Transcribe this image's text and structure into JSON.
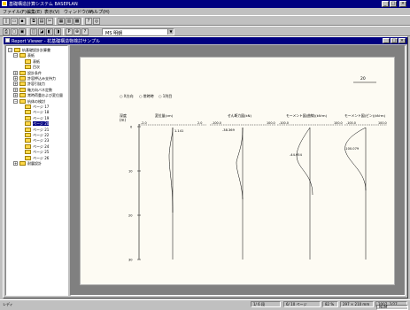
{
  "app": {
    "title": "基礎構造計算システム BASEPLAN",
    "min": "_",
    "max": "□",
    "close": "×"
  },
  "menu": [
    "ファイル(F)",
    "編集(E)",
    "表示(V)",
    "ウィンドウ(W)",
    "ヘルプ(H)"
  ],
  "toolbar": {
    "row1": [
      "new-icon",
      "open-icon",
      "save-icon",
      "copy-icon",
      "paste-icon",
      "table-icon",
      "chart-icon",
      "cut-icon",
      "question-icon",
      "help-icon"
    ],
    "row2": [
      "print-icon",
      "page-icon",
      "page-icon",
      "print-preview-icon",
      "preview-icon",
      "p-icon",
      "zoom-icon",
      "help-icon"
    ],
    "font_combo": "MS 明朝",
    "p_label": "P"
  },
  "doc": {
    "title": "Report Viewer - 杭基礎構造物検討サンプル"
  },
  "tree": [
    {
      "label": "杭基礎設計計算書",
      "level": 0,
      "exp": "−"
    },
    {
      "label": "表紙",
      "level": 1,
      "exp": "−"
    },
    {
      "label": "表紙",
      "level": 2,
      "exp": ""
    },
    {
      "label": "目次",
      "level": 2,
      "exp": ""
    },
    {
      "label": "設計条件",
      "level": 1,
      "exp": "+"
    },
    {
      "label": "許容押込み支持力",
      "level": 1,
      "exp": "+"
    },
    {
      "label": "許容引抜力",
      "level": 1,
      "exp": "+"
    },
    {
      "label": "軸方向バネ定数",
      "level": 1,
      "exp": "+"
    },
    {
      "label": "常時荷重および変位量",
      "level": 1,
      "exp": "+"
    },
    {
      "label": "杭体の検討",
      "level": 1,
      "exp": "−"
    },
    {
      "label": "ページ 17",
      "level": 2,
      "exp": ""
    },
    {
      "label": "ページ 18",
      "level": 2,
      "exp": ""
    },
    {
      "label": "ページ 19",
      "level": 2,
      "exp": ""
    },
    {
      "label": "ページ 20",
      "level": 2,
      "exp": "",
      "selected": true
    },
    {
      "label": "ページ 21",
      "level": 2,
      "exp": ""
    },
    {
      "label": "ページ 22",
      "level": 2,
      "exp": ""
    },
    {
      "label": "ページ 23",
      "level": 2,
      "exp": ""
    },
    {
      "label": "ページ 24",
      "level": 2,
      "exp": ""
    },
    {
      "label": "ページ 25",
      "level": 2,
      "exp": ""
    },
    {
      "label": "ページ 26",
      "level": 2,
      "exp": ""
    },
    {
      "label": "耐震設計",
      "level": 1,
      "exp": "+"
    }
  ],
  "page": {
    "page_number": "20",
    "legend": [
      "○ X方向",
      "○ 常時時",
      "○ 1列目"
    ],
    "depth_label": "深度",
    "depth_unit": "(m)",
    "columns": [
      {
        "title": "変位量(cm)",
        "left": "-2.0",
        "right": "2.0",
        "value": "1.141"
      },
      {
        "title": "せん断力図(kN)",
        "left": "-100.0",
        "right": "100.0",
        "value": "-38.369"
      },
      {
        "title": "モーメント図(曲線)(kN·m)",
        "left": "-100.0",
        "right": "100.0",
        "value": "-44.954"
      },
      {
        "title": "モーメント図(ピン)(kN·m)",
        "left": "-100.0",
        "right": "100.0",
        "value": "-100.079"
      }
    ],
    "depth_ticks": [
      "0",
      "10",
      "20",
      "30"
    ]
  },
  "status": {
    "left": "レディ",
    "panels": [
      "1/ 6 段",
      "6/ 10 ページ",
      "82 %",
      "297 × 210 mm",
      "2007, 2/27"
    ],
    "far_right": "NUM"
  }
}
